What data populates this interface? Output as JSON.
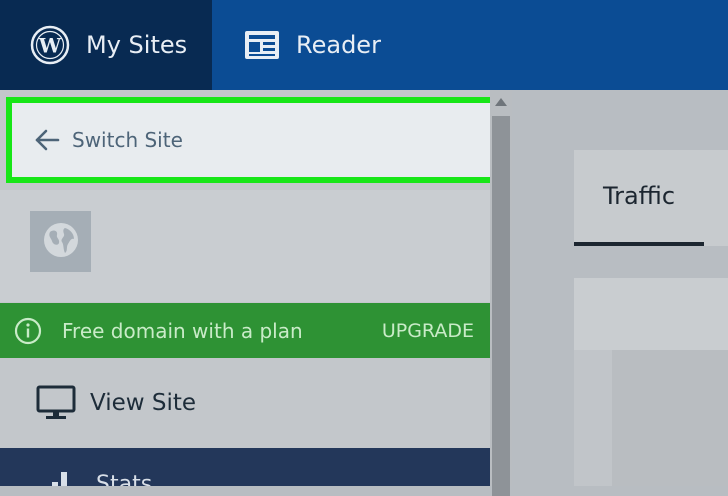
{
  "masterbar": {
    "my_sites_label": "My Sites",
    "reader_label": "Reader",
    "bg_color": "#0b4c94",
    "active_bg_color": "#082a52"
  },
  "sidebar": {
    "switch_site_label": "Switch Site",
    "highlight_color": "#17e617",
    "domain_banner": {
      "text": "Free domain with a plan",
      "action_label": "UPGRADE",
      "color": "#2e9234"
    },
    "view_site_label": "View Site",
    "stats_label": "Stats"
  },
  "main": {
    "tabs": [
      {
        "label": "Traffic",
        "active": true
      }
    ]
  },
  "icons": {
    "my_sites": "wordpress-logo-icon",
    "reader": "reader-icon",
    "switch_site": "arrow-left-icon",
    "site": "globe-icon",
    "banner": "info-icon",
    "view_site": "monitor-icon",
    "stats": "bar-chart-icon"
  }
}
